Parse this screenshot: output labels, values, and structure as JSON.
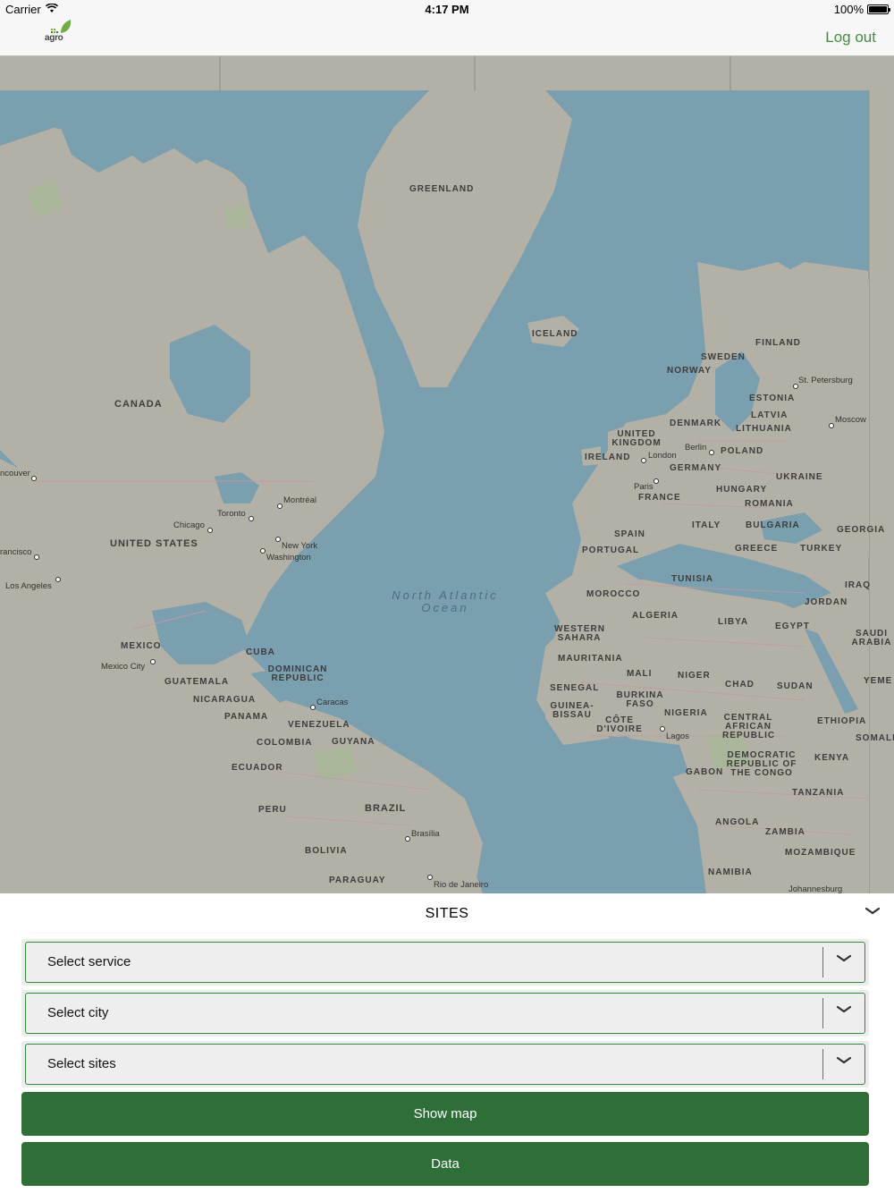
{
  "status_bar": {
    "carrier": "Carrier",
    "time": "4:17 PM",
    "battery": "100%"
  },
  "nav": {
    "logo_text": "agro",
    "logout": "Log out"
  },
  "map": {
    "countries": [
      "GREENLAND",
      "ICELAND",
      "CANADA",
      "UNITED STATES",
      "MEXICO",
      "CUBA",
      "DOMINICAN REPUBLIC",
      "GUATEMALA",
      "NICARAGUA",
      "PANAMA",
      "VENEZUELA",
      "GUYANA",
      "COLOMBIA",
      "ECUADOR",
      "PERU",
      "BRAZIL",
      "BOLIVIA",
      "PARAGUAY",
      "FINLAND",
      "SWEDEN",
      "NORWAY",
      "ESTONIA",
      "LATVIA",
      "LITHUANIA",
      "DENMARK",
      "UNITED KINGDOM",
      "IRELAND",
      "POLAND",
      "GERMANY",
      "UKRAINE",
      "FRANCE",
      "HUNGARY",
      "ROMANIA",
      "SPAIN",
      "PORTUGAL",
      "ITALY",
      "BULGARIA",
      "GEORGIA",
      "GREECE",
      "TURKEY",
      "TUNISIA",
      "MOROCCO",
      "ALGERIA",
      "LIBYA",
      "EGYPT",
      "IRAQ",
      "JORDAN",
      "SAUDI ARABIA",
      "WESTERN SAHARA",
      "MAURITANIA",
      "MALI",
      "NIGER",
      "CHAD",
      "SUDAN",
      "SENEGAL",
      "BURKINA FASO",
      "GUINEA-BISSAU",
      "CÔTE D'IVOIRE",
      "NIGERIA",
      "CENTRAL AFRICAN REPUBLIC",
      "ETHIOPIA",
      "SOMALI",
      "DEMOCRATIC REPUBLIC OF THE CONGO",
      "KENYA",
      "GABON",
      "TANZANIA",
      "ANGOLA",
      "ZAMBIA",
      "MOZAMBIQUE",
      "NAMIBIA",
      "YEME"
    ],
    "cities": [
      "St. Petersburg",
      "Moscow",
      "Berlin",
      "London",
      "Paris",
      "Montréal",
      "Toronto",
      "Chicago",
      "New York",
      "Washington",
      "ncouver",
      "rancisco",
      "Los Angeles",
      "Mexico City",
      "Caracas",
      "Brasília",
      "Rio de Janeiro",
      "Lagos",
      "Johannesburg"
    ],
    "ocean": "North Atlantic Ocean"
  },
  "panel": {
    "title": "SITES",
    "selects": [
      "Select service",
      "Select city",
      "Select sites"
    ],
    "show_map": "Show map",
    "data": "Data"
  },
  "colors": {
    "accent": "#3f8f3b",
    "button": "#2e6f37",
    "water": "#7a9fae",
    "land": "#b3b0a5"
  }
}
